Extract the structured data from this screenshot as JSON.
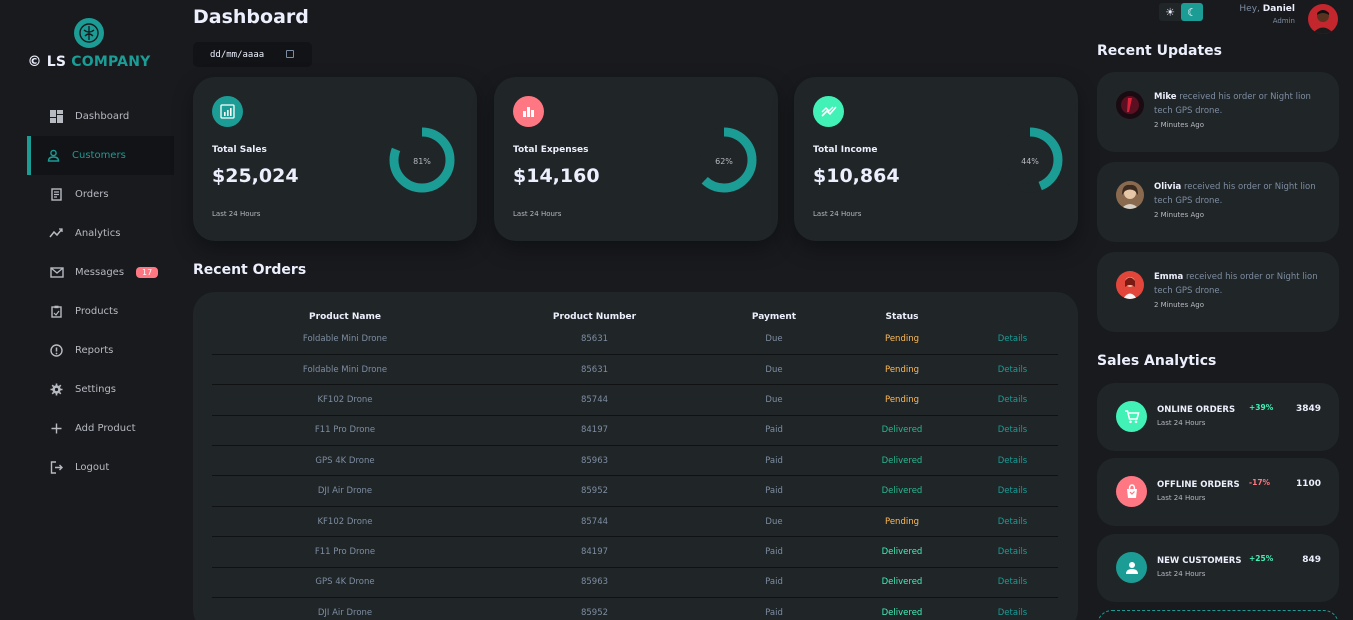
{
  "brand": {
    "prefix": "© LS",
    "accent": "COMPANY"
  },
  "nav": [
    {
      "label": "Dashboard",
      "icon": "grid-icon"
    },
    {
      "label": "Customers",
      "icon": "person-icon",
      "active": true
    },
    {
      "label": "Orders",
      "icon": "receipt-icon"
    },
    {
      "label": "Analytics",
      "icon": "trend-icon"
    },
    {
      "label": "Messages",
      "icon": "mail-icon",
      "badge": "17"
    },
    {
      "label": "Products",
      "icon": "clipboard-icon"
    },
    {
      "label": "Reports",
      "icon": "info-icon"
    },
    {
      "label": "Settings",
      "icon": "gear-icon"
    },
    {
      "label": "Add Product",
      "icon": "plus-icon"
    },
    {
      "label": "Logout",
      "icon": "logout-icon"
    }
  ],
  "header": {
    "title": "Dashboard",
    "date_placeholder": "dd/mm/aaaa",
    "greeting": "Hey,",
    "user_name": "Daniel",
    "user_role": "Admin"
  },
  "cards": [
    {
      "label": "Total Sales",
      "value": "$25,024",
      "percent": 81,
      "percent_label": "81%",
      "foot": "Last 24 Hours",
      "color": "#1b9c95",
      "icon": "chart-icon"
    },
    {
      "label": "Total Expenses",
      "value": "$14,160",
      "percent": 62,
      "percent_label": "62%",
      "foot": "Last 24 Hours",
      "color": "#ff7782",
      "icon": "bar-chart-icon"
    },
    {
      "label": "Total Income",
      "value": "$10,864",
      "percent": 44,
      "percent_label": "44%",
      "foot": "Last 24 Hours",
      "color": "#41f1b6",
      "icon": "stocks-icon"
    }
  ],
  "orders": {
    "title": "Recent Orders",
    "headers": [
      "Product Name",
      "Product Number",
      "Payment",
      "Status",
      ""
    ],
    "rows": [
      {
        "name": "Foldable Mini Drone",
        "number": "85631",
        "payment": "Due",
        "status": "Pending",
        "details": "Details"
      },
      {
        "name": "Foldable Mini Drone",
        "number": "85631",
        "payment": "Due",
        "status": "Pending",
        "details": "Details"
      },
      {
        "name": "KF102 Drone",
        "number": "85744",
        "payment": "Due",
        "status": "Pending",
        "details": "Details"
      },
      {
        "name": "F11 Pro Drone",
        "number": "84197",
        "payment": "Paid",
        "status": "Delivered",
        "details": "Details"
      },
      {
        "name": "GPS 4K Drone",
        "number": "85963",
        "payment": "Paid",
        "status": "Delivered",
        "details": "Details"
      },
      {
        "name": "DJI Air Drone",
        "number": "85952",
        "payment": "Paid",
        "status": "Delivered",
        "details": "Details"
      },
      {
        "name": "KF102 Drone",
        "number": "85744",
        "payment": "Due",
        "status": "Pending",
        "details": "Details"
      },
      {
        "name": "F11 Pro Drone",
        "number": "84197",
        "payment": "Paid",
        "status": "Delivered",
        "details": "Details"
      },
      {
        "name": "GPS 4K Drone",
        "number": "85963",
        "payment": "Paid",
        "status": "Delivered",
        "details": "Details"
      },
      {
        "name": "DJI Air Drone",
        "number": "85952",
        "payment": "Paid",
        "status": "Delivered",
        "details": "Details"
      }
    ]
  },
  "updates": {
    "title": "Recent Updates",
    "items": [
      {
        "name": "Mike",
        "text": "received his order or Night lion tech GPS drone.",
        "time": "2 Minutes Ago",
        "avatar_color": "#5a1020"
      },
      {
        "name": "Olivia",
        "text": "received his order or Night lion tech GPS drone.",
        "time": "2 Minutes Ago",
        "avatar_color": "#caa88a"
      },
      {
        "name": "Emma",
        "text": "received his order or Night lion tech GPS drone.",
        "time": "2 Minutes Ago",
        "avatar_color": "#e2453a"
      }
    ]
  },
  "analytics": {
    "title": "Sales Analytics",
    "items": [
      {
        "name": "ONLINE ORDERS",
        "sub": "Last 24 Hours",
        "change": "+39%",
        "value": "3849",
        "color": "#41f1b6",
        "change_color": "#41f1b6",
        "icon": "cart-icon"
      },
      {
        "name": "OFFLINE ORDERS",
        "sub": "Last 24 Hours",
        "change": "-17%",
        "value": "1100",
        "color": "#ff7782",
        "change_color": "#ff7782",
        "icon": "bag-icon"
      },
      {
        "name": "NEW CUSTOMERS",
        "sub": "Last 24 Hours",
        "change": "+25%",
        "value": "849",
        "color": "#1b9c95",
        "change_color": "#41f1b6",
        "icon": "person-icon"
      }
    ]
  }
}
